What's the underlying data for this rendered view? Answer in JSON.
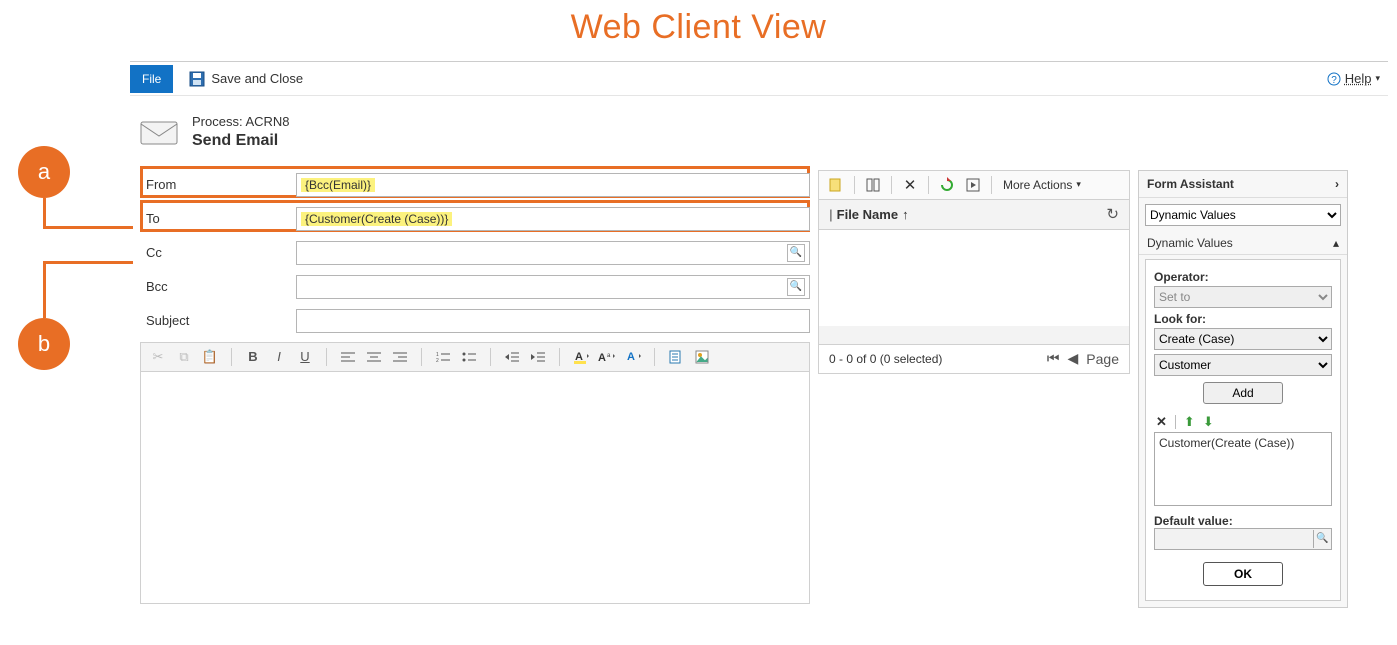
{
  "page_title": "Web Client View",
  "callouts": {
    "a": "a",
    "b": "b"
  },
  "toolbar": {
    "file_label": "File",
    "save_close_label": "Save and Close",
    "help_label": "Help"
  },
  "header": {
    "process_label": "Process: ACRN8",
    "title": "Send Email"
  },
  "form": {
    "from_label": "From",
    "from_value": "{Bcc(Email)}",
    "to_label": "To",
    "to_value": "{Customer(Create (Case))}",
    "cc_label": "Cc",
    "cc_value": "",
    "bcc_label": "Bcc",
    "bcc_value": "",
    "subject_label": "Subject",
    "subject_value": ""
  },
  "file_panel": {
    "more_actions_label": "More Actions",
    "column_header": "File Name",
    "sort_arrow": "↑",
    "status_text": "0 - 0 of 0 (0 selected)",
    "page_label": "Page"
  },
  "form_assistant": {
    "title": "Form Assistant",
    "top_select": "Dynamic Values",
    "section_label": "Dynamic Values",
    "operator_label": "Operator:",
    "operator_value": "Set to",
    "lookfor_label": "Look for:",
    "lookfor_value": "Create (Case)",
    "lookfor_value2": "Customer",
    "add_label": "Add",
    "list_item": "Customer(Create (Case))",
    "default_label": "Default value:",
    "ok_label": "OK"
  }
}
